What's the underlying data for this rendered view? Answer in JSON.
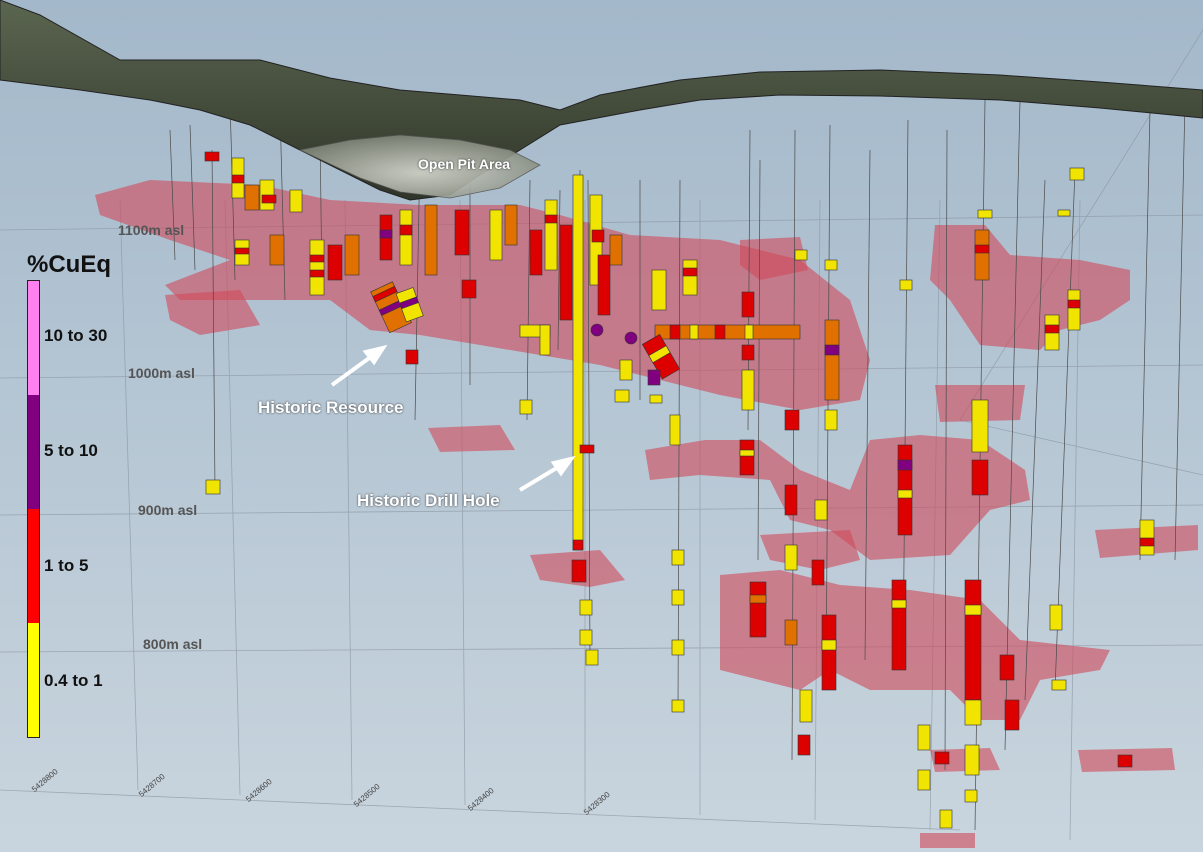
{
  "legend": {
    "title": "%CuEq",
    "items": [
      {
        "label": "10 to 30",
        "color": "#ff80ee"
      },
      {
        "label": "5 to 10",
        "color": "#800080"
      },
      {
        "label": "1 to 5",
        "color": "#ff0000"
      },
      {
        "label": "0.4 to 1",
        "color": "#ffff00"
      }
    ]
  },
  "elevations": [
    "1100m asl",
    "1000m asl",
    "900m asl",
    "800m asl"
  ],
  "annotations": {
    "open_pit": "Open Pit Area",
    "historic_resource": "Historic Resource",
    "historic_drill_hole": "Historic Drill Hole"
  },
  "northings": [
    "5428800",
    "5428700",
    "5428600",
    "5428500",
    "5428400",
    "5428300"
  ],
  "colors": {
    "sky_top": "#a3b8ca",
    "sky_bottom": "#c6d3dd",
    "resource_block": "#d04a5a",
    "terrain": "#4e5a45",
    "pit": "#bfc2b9"
  }
}
